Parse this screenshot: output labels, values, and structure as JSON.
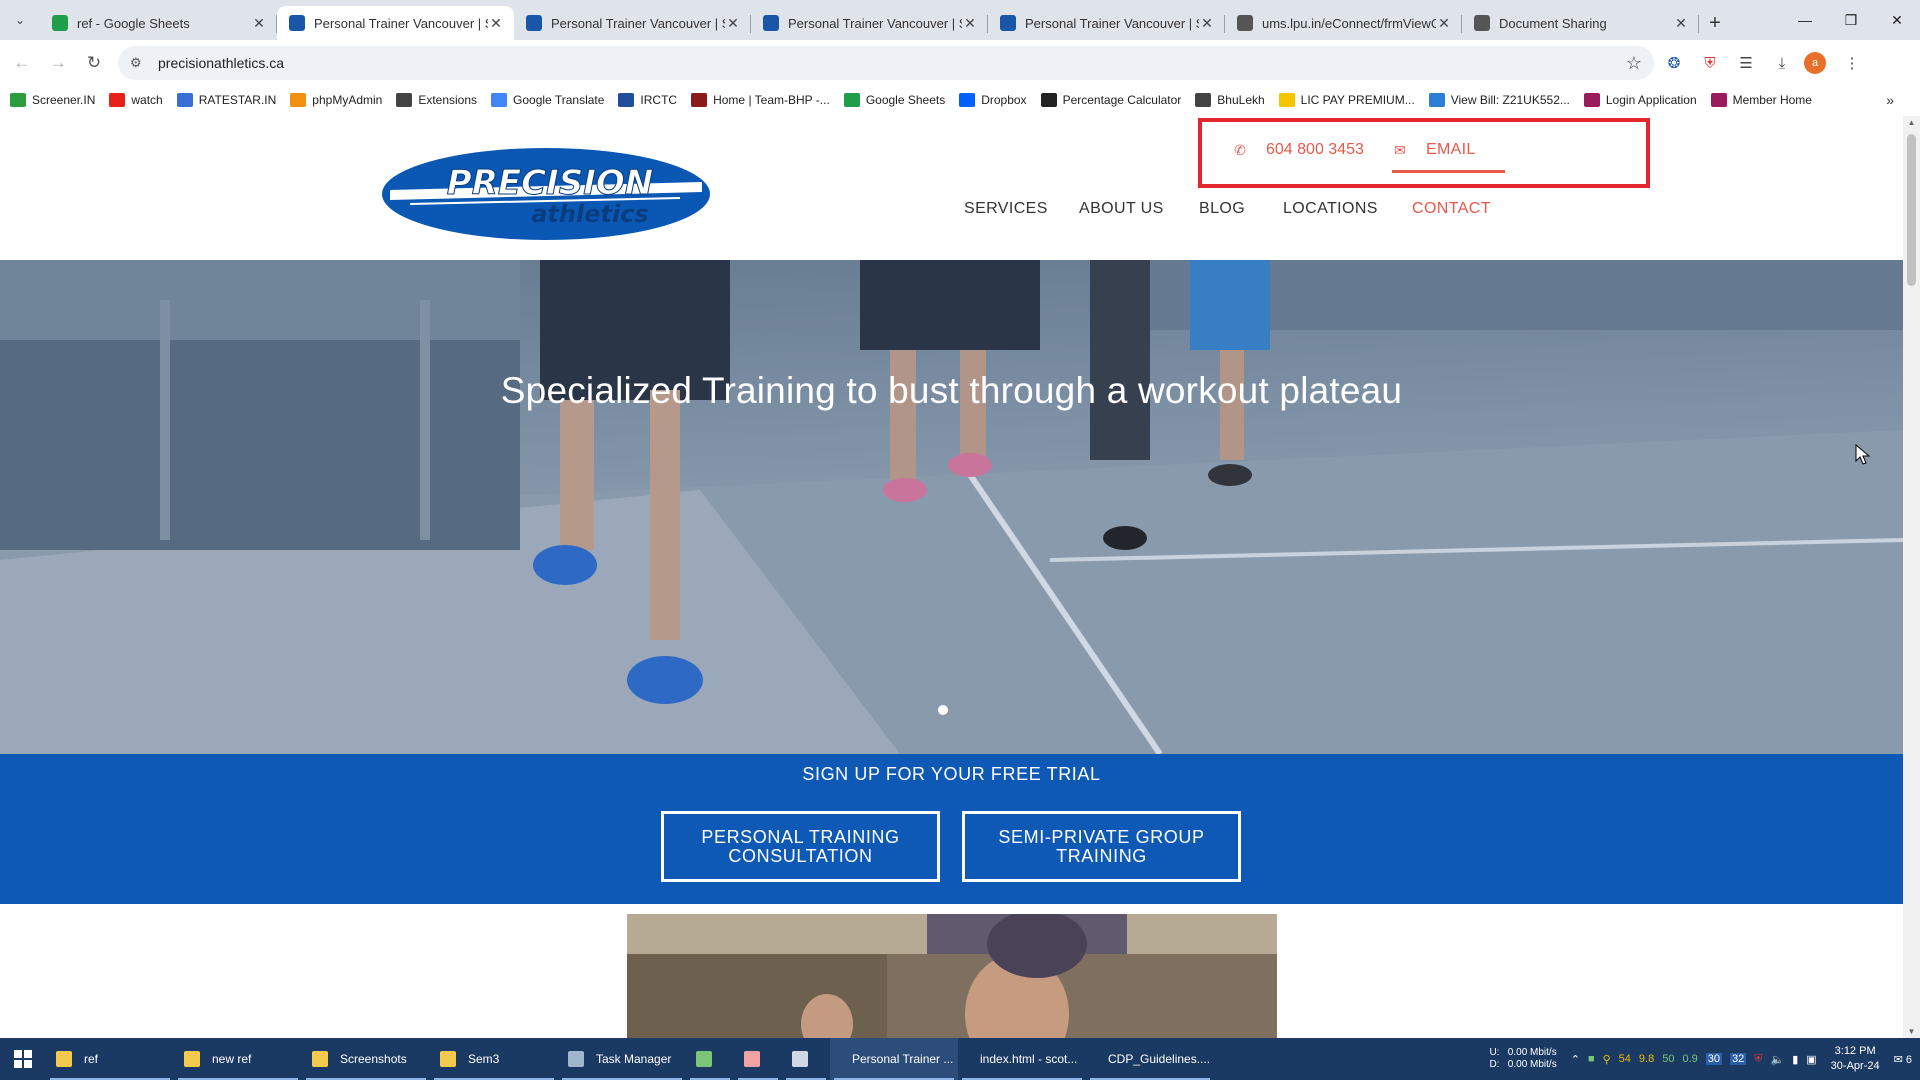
{
  "browser": {
    "tabs": [
      {
        "title": "ref - Google Sheets",
        "active": false,
        "favicon": "sheets-icon",
        "color": "#1e9e4a"
      },
      {
        "title": "Personal Trainer Vancouver | Sm",
        "active": true,
        "favicon": "swoosh-icon",
        "color": "#1a56a8"
      },
      {
        "title": "Personal Trainer Vancouver | Sm",
        "active": false,
        "favicon": "swoosh-icon",
        "color": "#1a56a8"
      },
      {
        "title": "Personal Trainer Vancouver | Sm",
        "active": false,
        "favicon": "swoosh-icon",
        "color": "#1a56a8"
      },
      {
        "title": "Personal Trainer Vancouver | Sm",
        "active": false,
        "favicon": "swoosh-icon",
        "color": "#1a56a8"
      },
      {
        "title": "ums.lpu.in/eConnect/frmViewC",
        "active": false,
        "favicon": "globe-icon",
        "color": "#555555"
      },
      {
        "title": "Document Sharing",
        "active": false,
        "favicon": "globe-icon",
        "color": "#555555"
      }
    ],
    "url": "precisionathletics.ca",
    "profile_initial": "a",
    "bookmarks": [
      {
        "label": "Screener.IN",
        "icon": "bar-chart-icon",
        "color": "#2e9d3e"
      },
      {
        "label": "watch",
        "icon": "youtube-icon",
        "color": "#e62117"
      },
      {
        "label": "RATESTAR.IN",
        "icon": "star-icon",
        "color": "#3b6fd6"
      },
      {
        "label": "phpMyAdmin",
        "icon": "sail-icon",
        "color": "#f29111"
      },
      {
        "label": "Extensions",
        "icon": "puzzle-icon",
        "color": "#444444"
      },
      {
        "label": "Google Translate",
        "icon": "translate-icon",
        "color": "#4285f4"
      },
      {
        "label": "IRCTC",
        "icon": "train-icon",
        "color": "#1f4e9a"
      },
      {
        "label": "Home | Team-BHP -...",
        "icon": "team-bhp-icon",
        "color": "#8a1a1a"
      },
      {
        "label": "Google Sheets",
        "icon": "sheets-icon",
        "color": "#1e9e4a"
      },
      {
        "label": "Dropbox",
        "icon": "dropbox-icon",
        "color": "#0061fe"
      },
      {
        "label": "Percentage Calculator",
        "icon": "percent-icon",
        "color": "#222222"
      },
      {
        "label": "BhuLekh",
        "icon": "globe-icon",
        "color": "#444444"
      },
      {
        "label": "LIC PAY PREMIUM...",
        "icon": "lic-icon",
        "color": "#f3c600"
      },
      {
        "label": "View Bill: Z21UK552...",
        "icon": "bill-icon",
        "color": "#2a7fd4"
      },
      {
        "label": "Login Application",
        "icon": "login-icon",
        "color": "#9b1c5d"
      },
      {
        "label": "Member Home",
        "icon": "member-icon",
        "color": "#9b1c5d"
      }
    ]
  },
  "site": {
    "logo": {
      "line1": "PRECISION",
      "line2": "athletics",
      "color": "#0a58b3"
    },
    "contact": {
      "phone": "604 800 3453",
      "email_label": "EMAIL",
      "accent": "#e8584b",
      "box_border": "#e3262f"
    },
    "nav": [
      {
        "label": "SERVICES",
        "active": false
      },
      {
        "label": "ABOUT US",
        "active": false
      },
      {
        "label": "BLOG",
        "active": false
      },
      {
        "label": "LOCATIONS",
        "active": false
      },
      {
        "label": "CONTACT",
        "active": true
      }
    ],
    "hero": {
      "title": "Specialized Training to bust through a workout plateau"
    },
    "signup": {
      "title": "SIGN UP FOR YOUR FREE TRIAL",
      "buttons": [
        "PERSONAL TRAINING CONSULTATION",
        "SEMI-PRIVATE GROUP TRAINING"
      ],
      "bg": "#0d59b5"
    }
  },
  "taskbar": {
    "items": [
      {
        "label": "ref",
        "icon": "folder-icon",
        "color": "#f2c94c"
      },
      {
        "label": "new ref",
        "icon": "folder-icon",
        "color": "#f2c94c"
      },
      {
        "label": "Screenshots",
        "icon": "folder-icon",
        "color": "#f2c94c"
      },
      {
        "label": "Sem3",
        "icon": "folder-icon",
        "color": "#f2c94c"
      },
      {
        "label": "Task Manager",
        "icon": "task-manager-icon",
        "color": "#9fb6cf"
      },
      {
        "label": "",
        "icon": "notepad-plus-icon",
        "color": "#7cc576"
      },
      {
        "label": "",
        "icon": "pig-icon",
        "color": "#f4a3a3"
      },
      {
        "label": "",
        "icon": "document-icon",
        "color": "#cfd8e3"
      },
      {
        "label": "Personal Trainer ...",
        "icon": "chrome-icon",
        "color": "#e94235"
      },
      {
        "label": "index.html - scot...",
        "icon": "vscode-icon",
        "color": "#2a8ee0"
      },
      {
        "label": "CDP_Guidelines....",
        "icon": "pdf-icon",
        "color": "#f2d000"
      }
    ],
    "network": {
      "up_label": "U:",
      "up": "0.00 Mbit/s",
      "down_label": "D:",
      "down": "0.00 Mbit/s"
    },
    "tray_numbers": [
      "54",
      "9.8",
      "50",
      "0.9",
      "30",
      "32"
    ],
    "time": "3:12 PM",
    "date": "30-Apr-24",
    "notifications": "6"
  }
}
